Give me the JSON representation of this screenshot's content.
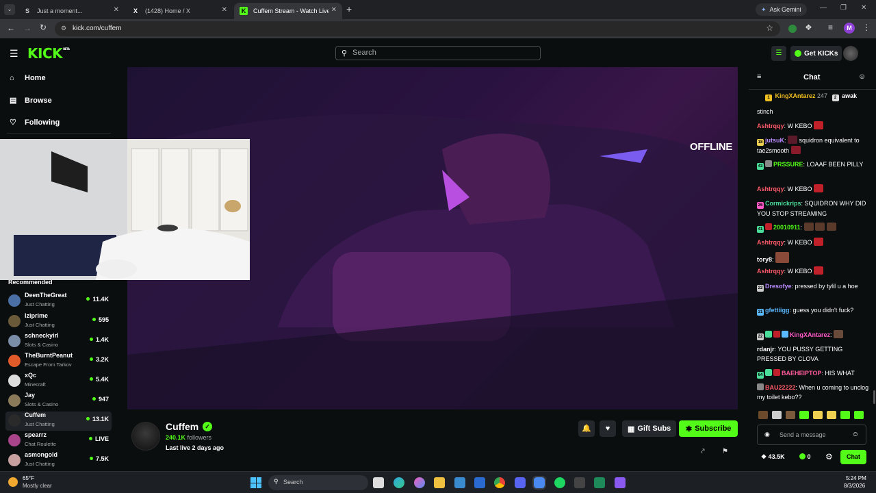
{
  "browser": {
    "tabs": [
      {
        "title": "Just a moment..."
      },
      {
        "title": "(1428) Home / X"
      },
      {
        "title": "Cuffem Stream - Watch Live on"
      }
    ],
    "ask_gemini": "Ask Gemini",
    "url": "kick.com/cuffem",
    "profile_initial": "M"
  },
  "kick": {
    "logo": "KICK",
    "beta": "BETA",
    "search_placeholder": "Search",
    "get_kicks": "Get KICKs"
  },
  "sidebar": {
    "nav": [
      {
        "label": "Home",
        "icon": "home-icon"
      },
      {
        "label": "Browse",
        "icon": "browse-icon"
      },
      {
        "label": "Following",
        "icon": "heart-icon"
      }
    ],
    "recommended_title": "Recommended",
    "recommended": [
      {
        "name": "DeenTheGreat",
        "category": "Just Chatting",
        "viewers": "11.4K",
        "color": "#4a6fa5"
      },
      {
        "name": "lziprime",
        "category": "Just Chatting",
        "viewers": "595",
        "color": "#6b5a3a"
      },
      {
        "name": "schneckyirl",
        "category": "Slots & Casino",
        "viewers": "1.4K",
        "color": "#7a8ea8"
      },
      {
        "name": "TheBurntPeanut",
        "category": "Escape From Tarkov",
        "viewers": "3.2K",
        "color": "#e05a2a"
      },
      {
        "name": "xQc",
        "category": "Minecraft",
        "viewers": "5.4K",
        "color": "#dddddd"
      },
      {
        "name": "Jay",
        "category": "Slots & Casino",
        "viewers": "947",
        "color": "#8a7a5a"
      },
      {
        "name": "Cuffem",
        "category": "Just Chatting",
        "viewers": "13.1K",
        "color": "#2a2a2a"
      },
      {
        "name": "spearrz",
        "category": "Chat Roulette",
        "viewers": "LIVE",
        "color": "#a8458a"
      },
      {
        "name": "asmongold",
        "category": "Just Chatting",
        "viewers": "7.5K",
        "color": "#c8a0a0"
      }
    ]
  },
  "player": {
    "offline_label": "OFFLINE"
  },
  "channel": {
    "name": "Cuffem",
    "followers_count": "240.1K",
    "followers_label": "followers",
    "last_live": "Last live 2 days ago",
    "gift_subs": "Gift Subs",
    "subscribe": "Subscribe"
  },
  "chat": {
    "title": "Chat",
    "top_gifters": [
      {
        "name": "KingXAntarez",
        "count": "247"
      },
      {
        "name": "awak",
        "count": ""
      }
    ],
    "messages": [
      {
        "user": "",
        "color": "#ffffff",
        "text": "stinch"
      },
      {
        "user": "Ashtrqqy",
        "color": "#ff5a6a",
        "text": "W KEBO"
      },
      {
        "user": "jutsuK",
        "color": "#b98cff",
        "text": "squidron equivalent to tae2smooth"
      },
      {
        "user": "PRSSURE",
        "color": "#53fc18",
        "text": "LOAAF BEEN PILLY"
      },
      {
        "user": "Ashtrqqy",
        "color": "#ff5a6a",
        "text": "W KEBO"
      },
      {
        "user": "Cormickrips",
        "color": "#4ade9a",
        "text": "SQUIDRON WHY DID YOU STOP STREAMING"
      },
      {
        "user": "20010911",
        "color": "#53fc18",
        "text": ""
      },
      {
        "user": "Ashtrqqy",
        "color": "#ff5a6a",
        "text": "W KEBO"
      },
      {
        "user": "tory8",
        "color": "#ffffff",
        "text": ""
      },
      {
        "user": "Ashtrqqy",
        "color": "#ff5a6a",
        "text": "W KEBO"
      },
      {
        "user": "Dresofye",
        "color": "#b98cff",
        "text": "pressed by tylil u a hoe"
      },
      {
        "user": "gfettiigg",
        "color": "#5ab8ff",
        "text": "guess you didn't fuck?"
      },
      {
        "user": "KingXAntarez",
        "color": "#ff5ac8",
        "text": ""
      },
      {
        "user": "rdanjr",
        "color": "#ffffff",
        "text": "YOU PUSSY GETTING PRESSED BY CLOVA"
      },
      {
        "user": "BAEHEIPTOP",
        "color": "#ff5a9a",
        "text": "HIS WHAT"
      },
      {
        "user": "BAU22222",
        "color": "#ff5a6a",
        "text": "When u coming to unclog my toilet kebo??"
      }
    ],
    "input_placeholder": "Send a message",
    "kicks_count": "43.5K",
    "points": "0",
    "chat_button": "Chat"
  },
  "taskbar": {
    "weather_temp": "65°F",
    "weather_desc": "Mostly clear",
    "search_placeholder": "Search",
    "time": "5:24 PM",
    "date": "8/3/2026"
  }
}
